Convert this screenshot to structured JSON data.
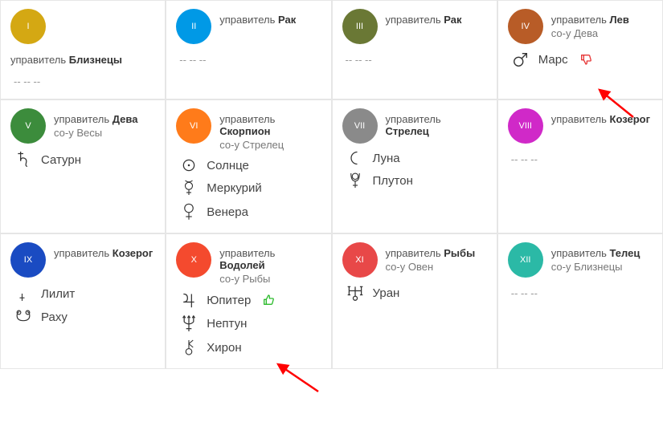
{
  "labels": {
    "ruler": "управитель",
    "coruler_prefix": "со-у",
    "placeholder": "-- -- --"
  },
  "colors": {
    "I": "#d4a813",
    "II": "#0099e6",
    "III": "#6a7835",
    "IV": "#b85c27",
    "V": "#3c8c3c",
    "VI": "#ff7b1a",
    "VII": "#8a8a8a",
    "VIII": "#d029c8",
    "IX": "#1a4bc2",
    "X": "#f44a2e",
    "XI": "#e84848",
    "XII": "#2bb9a6"
  },
  "houses": [
    {
      "num": "I",
      "ruler": "Близнецы",
      "coruler": null,
      "planets": [],
      "vert_head": true
    },
    {
      "num": "II",
      "ruler": "Рак",
      "coruler": null,
      "planets": []
    },
    {
      "num": "III",
      "ruler": "Рак",
      "coruler": null,
      "planets": []
    },
    {
      "num": "IV",
      "ruler": "Лев",
      "coruler": "Дева",
      "planets": [
        {
          "name": "Марс",
          "icon": "mars",
          "thumb": "down"
        }
      ]
    },
    {
      "num": "V",
      "ruler": "Дева",
      "coruler": "Весы",
      "planets": [
        {
          "name": "Сатурн",
          "icon": "saturn"
        }
      ]
    },
    {
      "num": "VI",
      "ruler": "Скорпион",
      "coruler": "Стрелец",
      "planets": [
        {
          "name": "Солнце",
          "icon": "sun"
        },
        {
          "name": "Меркурий",
          "icon": "mercury"
        },
        {
          "name": "Венера",
          "icon": "venus"
        }
      ]
    },
    {
      "num": "VII",
      "ruler": "Стрелец",
      "coruler": null,
      "planets": [
        {
          "name": "Луна",
          "icon": "moon"
        },
        {
          "name": "Плутон",
          "icon": "pluto"
        }
      ]
    },
    {
      "num": "VIII",
      "ruler": "Козерог",
      "coruler": null,
      "planets": []
    },
    {
      "num": "IX",
      "ruler": "Козерог",
      "coruler": null,
      "planets": [
        {
          "name": "Лилит",
          "icon": "lilith"
        },
        {
          "name": "Раху",
          "icon": "rahu"
        }
      ]
    },
    {
      "num": "X",
      "ruler": "Водолей",
      "coruler": "Рыбы",
      "planets": [
        {
          "name": "Юпитер",
          "icon": "jupiter",
          "thumb": "up"
        },
        {
          "name": "Нептун",
          "icon": "neptune"
        },
        {
          "name": "Хирон",
          "icon": "chiron"
        }
      ]
    },
    {
      "num": "XI",
      "ruler": "Рыбы",
      "coruler": "Овен",
      "planets": [
        {
          "name": "Уран",
          "icon": "uranus"
        }
      ]
    },
    {
      "num": "XII",
      "ruler": "Телец",
      "coruler": "Близнецы",
      "planets": []
    }
  ]
}
